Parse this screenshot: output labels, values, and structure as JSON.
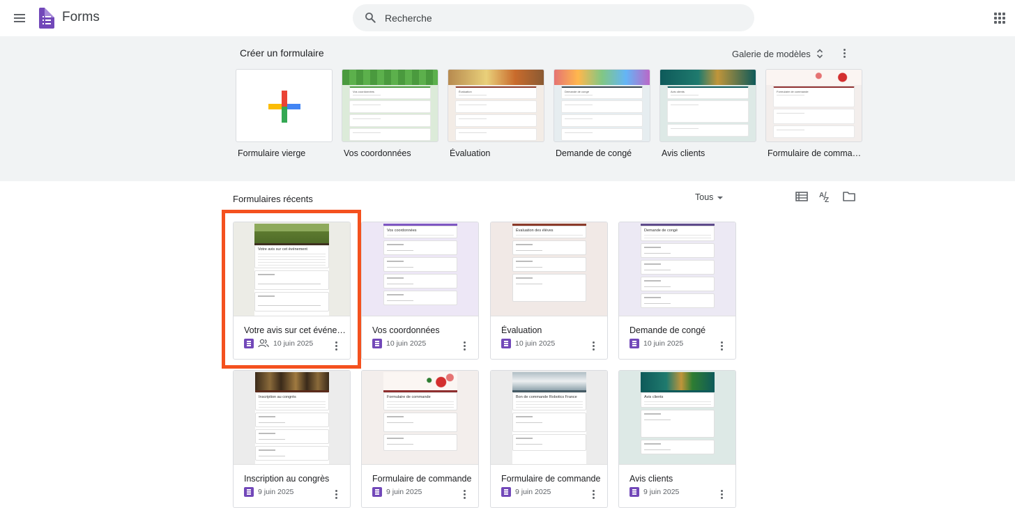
{
  "header": {
    "app_title": "Forms",
    "search_placeholder": "Recherche"
  },
  "templates": {
    "section_title": "Créer un formulaire",
    "gallery_label": "Galerie de modèles",
    "items": [
      {
        "label": "Formulaire vierge"
      },
      {
        "label": "Vos coordonnées",
        "form_title": "Vos coordonnées"
      },
      {
        "label": "Évaluation",
        "form_title": "Évaluation"
      },
      {
        "label": "Demande de congé",
        "form_title": "Demande de congé"
      },
      {
        "label": "Avis clients",
        "form_title": "Avis clients"
      },
      {
        "label": "Formulaire de comman…",
        "form_title": "Formulaire de commande"
      }
    ]
  },
  "recent": {
    "section_title": "Formulaires récents",
    "owner_filter": "Tous",
    "forms": [
      {
        "title": "Votre avis sur cet événem…",
        "preview_title": "Votre avis sur cet événement",
        "date": "10 juin 2025",
        "shared": true
      },
      {
        "title": "Vos coordonnées",
        "preview_title": "Vos coordonnées",
        "date": "10 juin 2025",
        "shared": false
      },
      {
        "title": "Évaluation",
        "preview_title": "Évaluation des élèves",
        "date": "10 juin 2025",
        "shared": false
      },
      {
        "title": "Demande de congé",
        "preview_title": "Demande de congé",
        "date": "10 juin 2025",
        "shared": false
      },
      {
        "title": "Inscription au congrès",
        "preview_title": "Inscription au congrès",
        "date": "9 juin 2025",
        "shared": false
      },
      {
        "title": "Formulaire de commande",
        "preview_title": "Formulaire de commande",
        "date": "9 juin 2025",
        "shared": false
      },
      {
        "title": "Formulaire de commande",
        "preview_title": "Bon de commande Robotics France",
        "date": "9 juin 2025",
        "shared": false
      },
      {
        "title": "Avis clients",
        "preview_title": "Avis clients",
        "date": "9 juin 2025",
        "shared": false
      }
    ]
  },
  "colors": {
    "highlight": "#f4511e",
    "forms_purple": "#7248b9"
  }
}
